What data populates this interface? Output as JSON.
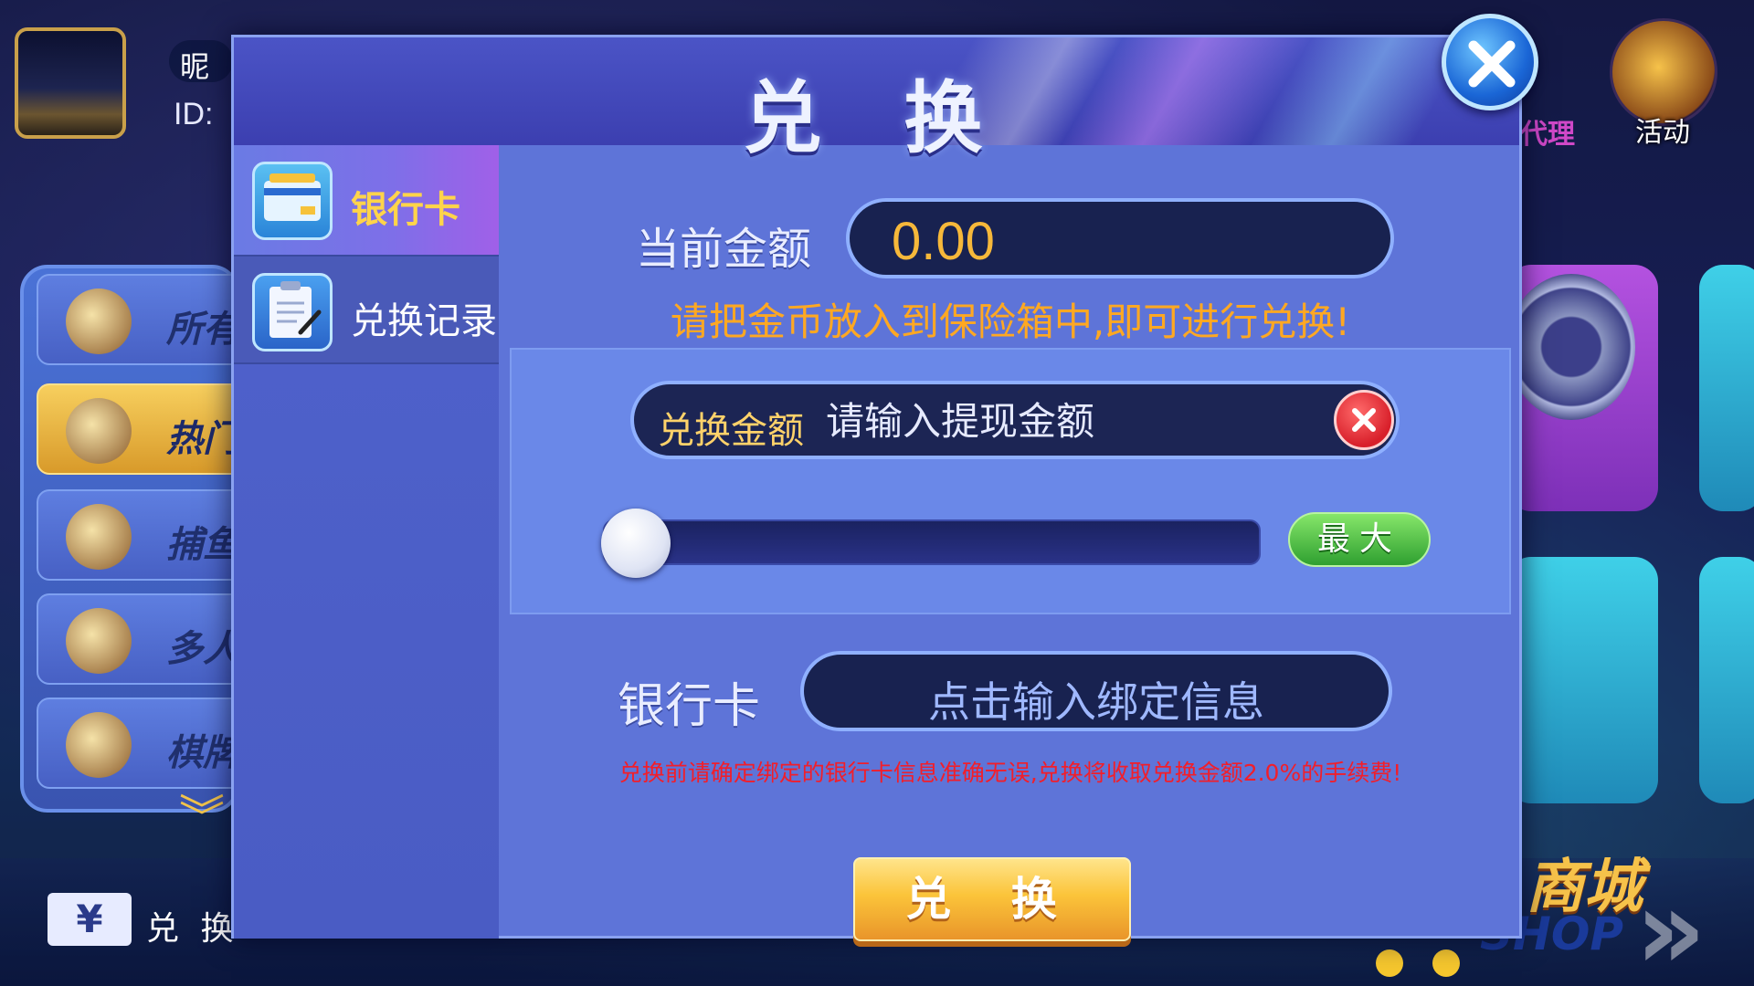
{
  "lobby": {
    "nickname_label": "昵",
    "id_label": "ID: ",
    "categories": [
      {
        "label": "所有",
        "icon": "cards-hat-icon"
      },
      {
        "label": "热门",
        "icon": "poker-table-icon"
      },
      {
        "label": "捕鱼",
        "icon": "pufferfish-icon"
      },
      {
        "label": "多人",
        "icon": "trophy-icon"
      },
      {
        "label": "棋牌",
        "icon": "cards-coins-icon"
      }
    ],
    "activity_label": "活动",
    "agent_label": "代理",
    "shop_label": "商城",
    "shop_sub": "SHOP",
    "bottom": {
      "exchange_label": "兑 换",
      "exchange_icon": "¥"
    }
  },
  "dialog": {
    "title": "兑 换",
    "nav": [
      {
        "label": "银行卡",
        "icon": "bank-card-icon",
        "active": true
      },
      {
        "label": "兑换记录",
        "icon": "clipboard-icon",
        "active": false
      }
    ],
    "current_amount_label": "当前金额",
    "current_amount_value": "0.00",
    "tip_deposit": "请把金币放入到保险箱中,即可进行兑换!",
    "exchange_amount_label": "兑换金额",
    "exchange_amount_placeholder": "请输入提现金额",
    "exchange_amount_value": "",
    "slider_fraction": 0,
    "max_label": "最大",
    "bank_card_label": "银行卡",
    "bank_card_placeholder": "点击输入绑定信息",
    "tip_fee": "兑换前请确定绑定的银行卡信息准确无误,兑换将收取兑换金额2.0%的手续费!",
    "submit_label": "兑 换"
  },
  "colors": {
    "accent_orange": "#ffa822",
    "amount_gold": "#f6b83a",
    "warning_red": "#f21e2a",
    "max_green": "#2fa030",
    "submit_gold": "#fbc43a"
  }
}
